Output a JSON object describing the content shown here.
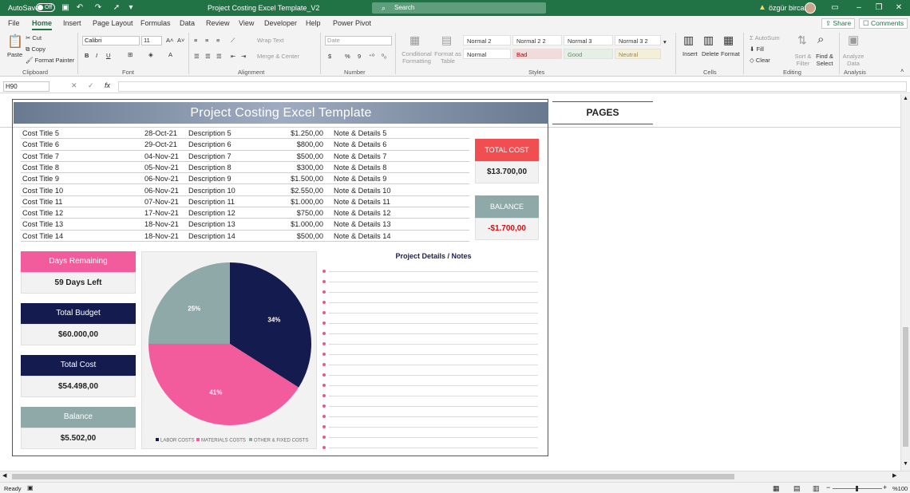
{
  "titlebar": {
    "autosave": "AutoSave",
    "autosave_state": "Off",
    "doc_title": "Project Costing Excel Template_V2",
    "search": "Search",
    "user": "özgür bircan"
  },
  "tabs": [
    "File",
    "Home",
    "Insert",
    "Page Layout",
    "Formulas",
    "Data",
    "Review",
    "View",
    "Developer",
    "Help",
    "Power Pivot"
  ],
  "share": "Share",
  "comments": "Comments",
  "ribbon": {
    "paste": "Paste",
    "cut": "Cut",
    "copy": "Copy",
    "format_painter": "Format Painter",
    "font_name": "Calibri",
    "font_size": "11",
    "wrap_text": "Wrap Text",
    "merge_center": "Merge & Center",
    "number_format": "Date",
    "conditional": "Conditional Formatting",
    "format_as": "Format as Table",
    "styles": [
      "Normal 2",
      "Normal 2 2",
      "Normal 3",
      "Normal 3 2",
      "Normal",
      "Bad",
      "Good",
      "Neutral"
    ],
    "insert": "Insert",
    "delete": "Delete",
    "format": "Format",
    "autosum": "AutoSum",
    "fill": "Fill",
    "clear": "Clear",
    "sort_filter": "Sort & Filter",
    "find_select": "Find & Select",
    "analyze_data": "Analyze Data",
    "groups": [
      "Clipboard",
      "Font",
      "Alignment",
      "Number",
      "Styles",
      "Cells",
      "Editing",
      "Analysis"
    ]
  },
  "namebox": "H90",
  "template": {
    "title": "Project Costing Excel Template",
    "pages": "PAGES",
    "rows": [
      {
        "title": "Cost Title 5",
        "date": "28-Oct-21",
        "desc": "Description 5",
        "amount": "$1.250,00",
        "note": "Note & Details 5"
      },
      {
        "title": "Cost Title 6",
        "date": "29-Oct-21",
        "desc": "Description 6",
        "amount": "$800,00",
        "note": "Note & Details 6"
      },
      {
        "title": "Cost Title 7",
        "date": "04-Nov-21",
        "desc": "Description 7",
        "amount": "$500,00",
        "note": "Note & Details 7"
      },
      {
        "title": "Cost Title 8",
        "date": "05-Nov-21",
        "desc": "Description 8",
        "amount": "$300,00",
        "note": "Note & Details 8"
      },
      {
        "title": "Cost Title 9",
        "date": "06-Nov-21",
        "desc": "Description 9",
        "amount": "$1.500,00",
        "note": "Note & Details 9"
      },
      {
        "title": "Cost Title 10",
        "date": "06-Nov-21",
        "desc": "Description 10",
        "amount": "$2.550,00",
        "note": "Note & Details 10"
      },
      {
        "title": "Cost Title 11",
        "date": "07-Nov-21",
        "desc": "Description 11",
        "amount": "$1.000,00",
        "note": "Note & Details 11"
      },
      {
        "title": "Cost Title 12",
        "date": "17-Nov-21",
        "desc": "Description 12",
        "amount": "$750,00",
        "note": "Note & Details 12"
      },
      {
        "title": "Cost Title 13",
        "date": "18-Nov-21",
        "desc": "Description 13",
        "amount": "$1.000,00",
        "note": "Note & Details 13"
      },
      {
        "title": "Cost Title 14",
        "date": "18-Nov-21",
        "desc": "Description 14",
        "amount": "$500,00",
        "note": "Note & Details 14"
      }
    ],
    "total_cost_label": "TOTAL COST",
    "total_cost_value": "$13.700,00",
    "balance_label": "BALANCE",
    "balance_value": "-$1.700,00",
    "cards": [
      {
        "label": "Days Remaining",
        "value": "59 Days Left",
        "color": "#f25c9c"
      },
      {
        "label": "Total Budget",
        "value": "$60.000,00",
        "color": "#141c4f"
      },
      {
        "label": "Total Cost",
        "value": "$54.498,00",
        "color": "#141c4f"
      },
      {
        "label": "Balance",
        "value": "$5.502,00",
        "color": "#8ea9a8"
      }
    ],
    "notes_title": "Project Details / Notes"
  },
  "chart_data": {
    "type": "pie",
    "categories": [
      "LABOR COSTS",
      "MATERIALS COSTS",
      "OTHER & FIXED COSTS"
    ],
    "values": [
      34,
      41,
      25
    ],
    "labels": [
      "34%",
      "41%",
      "25%"
    ],
    "colors": [
      "#141c4f",
      "#f25c9c",
      "#8ea9a8"
    ],
    "legend": "bottom"
  },
  "status": {
    "ready": "Ready",
    "zoom": "%100"
  }
}
